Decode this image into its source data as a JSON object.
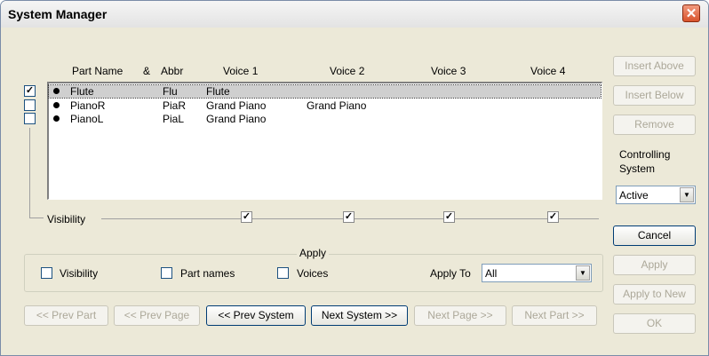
{
  "window": {
    "title": "System Manager"
  },
  "columns": {
    "part_name": "Part Name",
    "amp": "&",
    "abbr": "Abbr",
    "voice1": "Voice 1",
    "voice2": "Voice 2",
    "voice3": "Voice 3",
    "voice4": "Voice 4"
  },
  "parts": [
    {
      "name": "Flute",
      "abbr": "Flu",
      "voice1": "Flute",
      "voice2": "",
      "checked": true,
      "selected": true
    },
    {
      "name": "PianoR",
      "abbr": "PiaR",
      "voice1": "Grand Piano",
      "voice2": "Grand Piano",
      "checked": false,
      "selected": false
    },
    {
      "name": "PianoL",
      "abbr": "PiaL",
      "voice1": "Grand Piano",
      "voice2": "",
      "checked": false,
      "selected": false
    }
  ],
  "visibility_row": {
    "label": "Visibility",
    "voice_checks": [
      true,
      true,
      true,
      true
    ]
  },
  "apply_group": {
    "legend": "Apply",
    "visibility": "Visibility",
    "part_names": "Part names",
    "voices": "Voices",
    "apply_to_label": "Apply To",
    "apply_to_value": "All"
  },
  "nav": {
    "prev_part": "<< Prev Part",
    "prev_page": "<< Prev Page",
    "prev_system": "<< Prev System",
    "next_system": "Next System >>",
    "next_page": "Next Page >>",
    "next_part": "Next Part >>"
  },
  "side": {
    "insert_above": "Insert Above",
    "insert_below": "Insert Below",
    "remove": "Remove",
    "controlling_label": "Controlling",
    "system_label": "System",
    "controlling_value": "Active",
    "cancel": "Cancel",
    "apply": "Apply",
    "apply_to_new": "Apply to New",
    "ok": "OK"
  }
}
